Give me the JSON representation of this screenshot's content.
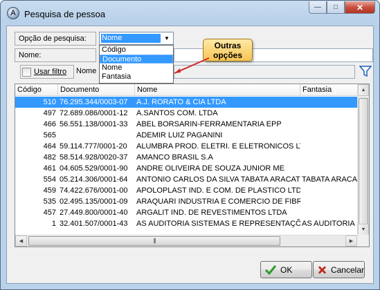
{
  "window": {
    "title": "Pesquisa de pessoa",
    "icon_letter": "A",
    "buttons": {
      "minimize": "—",
      "maximize": "□",
      "close": "✕"
    }
  },
  "search": {
    "option_label": "Opção de pesquisa:",
    "option_selected": "Nome",
    "options": [
      "Código",
      "Documento",
      "Nome",
      "Fantasia"
    ],
    "options_highlighted_index": 1,
    "name_label": "Nome:",
    "name_value": "",
    "filter_checkbox_label": "Usar filtro",
    "filter_field_label": "Nome",
    "filter_value": ""
  },
  "callout": {
    "line1": "Outras",
    "line2": "opções"
  },
  "grid": {
    "columns": [
      "Código",
      "Documento",
      "Nome",
      "Fantasia"
    ],
    "selected_row_index": 0,
    "rows": [
      [
        "510",
        "76.295.344/0003-07",
        "A.J. RORATO & CIA LTDA",
        ""
      ],
      [
        "497",
        "72.689.086/0001-12",
        "A.SANTOS COM. LTDA",
        ""
      ],
      [
        "466",
        "56.551.138/0001-33",
        "ABEL BORSARIN-FERRAMENTARIA EPP",
        ""
      ],
      [
        "565",
        "",
        "ADEMIR LUIZ PAGANINI",
        ""
      ],
      [
        "464",
        "59.114.777/0001-20",
        "ALUMBRA PROD. ELETRI. E ELETRONICOS LT",
        ""
      ],
      [
        "482",
        "58.514.928/0020-37",
        "AMANCO BRASIL S.A",
        ""
      ],
      [
        "461",
        "04.605.529/0001-90",
        "ANDRE OLIVEIRA DE SOUZA JUNIOR ME",
        ""
      ],
      [
        "554",
        "05.214.306/0001-64",
        "ANTONIO CARLOS DA SILVA TABATA ARACAT",
        "TABATA ARACA"
      ],
      [
        "459",
        "74.422.676/0001-00",
        "APOLOPLAST IND. E COM. DE PLASTICO LTDA",
        ""
      ],
      [
        "535",
        "02.495.135/0001-09",
        "ARAQUARI INDUSTRIA E COMERCIO DE FIBRA",
        ""
      ],
      [
        "457",
        "27.449.800/0001-40",
        "ARGALIT IND. DE REVESTIMENTOS LTDA",
        ""
      ],
      [
        "1",
        "32.401.507/0001-43",
        "AS AUDITORIA SISTEMAS E REPRESENTAÇÕ",
        "AS AUDITORIA S"
      ]
    ]
  },
  "footer": {
    "ok_label": "OK",
    "cancel_label": "Cancelar"
  },
  "colors": {
    "selection": "#3399ff",
    "title_gradient": "#b9d1ea",
    "ok_check": "#2b9a2b",
    "cancel_x": "#c0281e"
  }
}
